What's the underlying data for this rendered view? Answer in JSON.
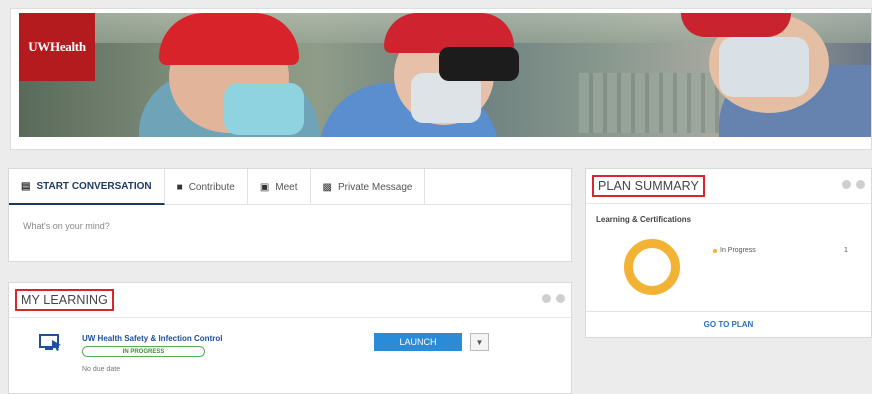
{
  "banner": {
    "logo_text": "UWHealth"
  },
  "conversation": {
    "tabs": [
      {
        "label": "START CONVERSATION",
        "icon": "chat-icon"
      },
      {
        "label": "Contribute",
        "icon": "folder-icon"
      },
      {
        "label": "Meet",
        "icon": "calendar-icon"
      },
      {
        "label": "Private Message",
        "icon": "private-message-icon"
      }
    ],
    "placeholder": "What's on your mind?"
  },
  "my_learning": {
    "title": "MY LEARNING",
    "course": {
      "title": "UW Health Safety & Infection Control",
      "status": "IN PROGRESS",
      "due": "No due date",
      "launch_label": "LAUNCH",
      "icon": "computer-icon"
    }
  },
  "plan_summary": {
    "title": "PLAN SUMMARY",
    "subtitle": "Learning & Certifications",
    "legend_label": "In Progress",
    "legend_value": "1",
    "goto_label": "GO TO PLAN"
  },
  "colors": {
    "brand_red": "#b31b1f",
    "accent_blue": "#2a8bd8",
    "progress_orange": "#f2b233",
    "status_green": "#56b04f"
  }
}
